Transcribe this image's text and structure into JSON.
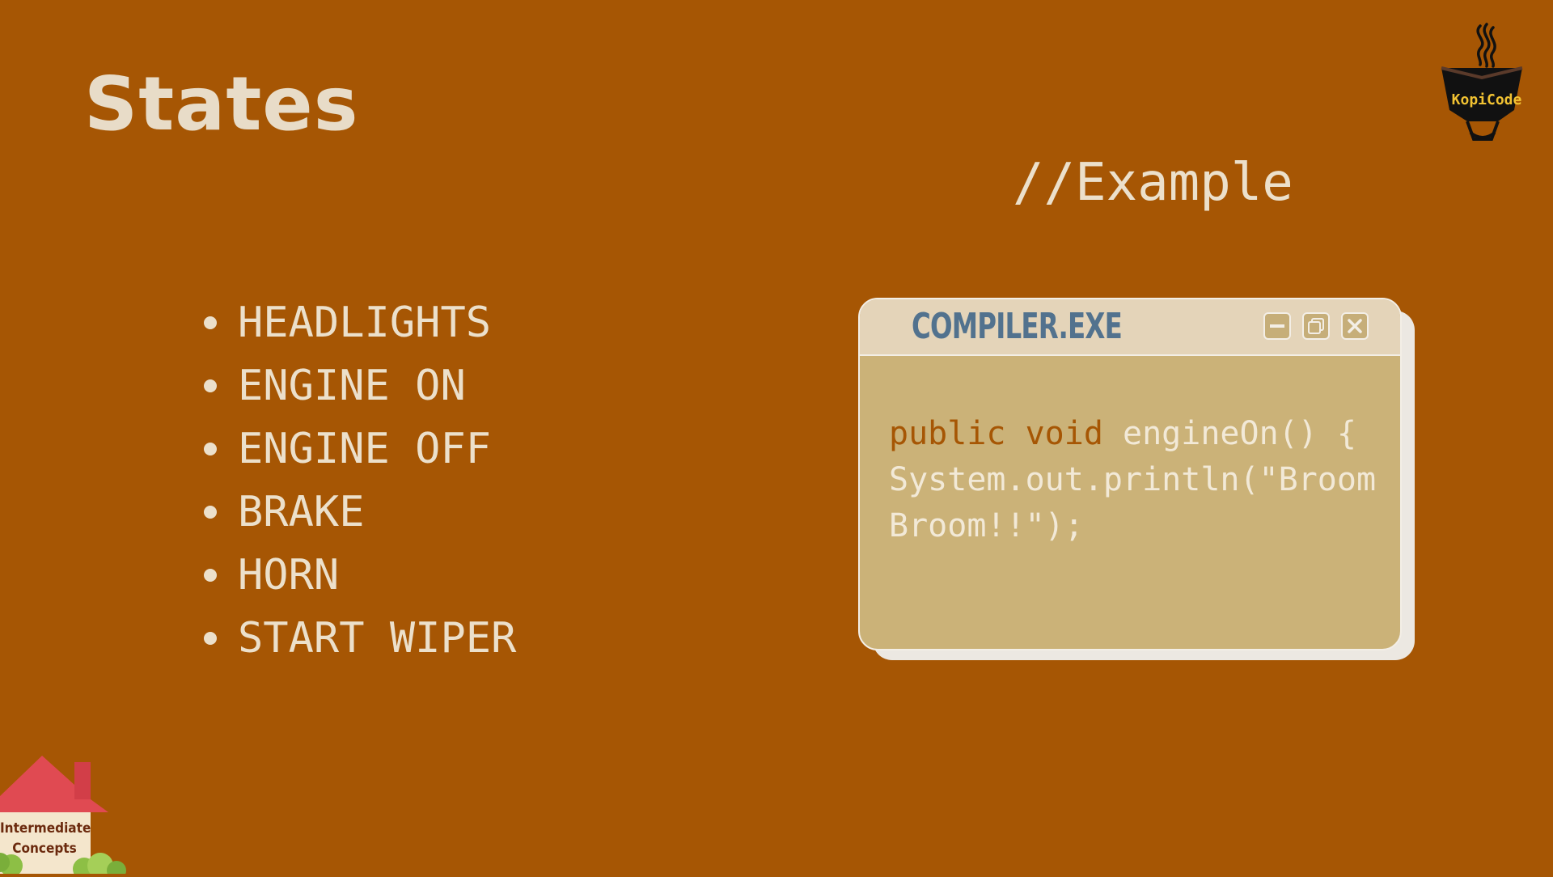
{
  "slide": {
    "title": "States",
    "example_label": "//Example",
    "background_color": "#A65604"
  },
  "states_list": {
    "items": [
      "HEADLIGHTS",
      "ENGINE ON",
      "ENGINE OFF",
      "BRAKE",
      "HORN",
      "START WIPER"
    ]
  },
  "compiler_window": {
    "title": "COMPILER.EXE",
    "buttons": {
      "minimize_icon": "minimize-icon",
      "maximize_icon": "maximize-icon",
      "close_icon": "close-icon"
    },
    "code": {
      "line1_keywords": "public void",
      "line1_rest": " engineOn() {",
      "line2": "System.out.println(\"Broom",
      "line3": "Broom!!\");"
    }
  },
  "logo": {
    "text": "KopiCode",
    "icon": "coffee-cup-icon"
  },
  "badge": {
    "line1": "Intermediate",
    "line2": "Concepts",
    "icon": "house-icon"
  },
  "colors": {
    "title_text": "#E8DCC8",
    "window_body": "#CBB278",
    "window_titlebar": "#E4D4B9",
    "window_title_text": "#52728E",
    "logo_text": "#F1C232",
    "house_roof": "#E04A52"
  }
}
